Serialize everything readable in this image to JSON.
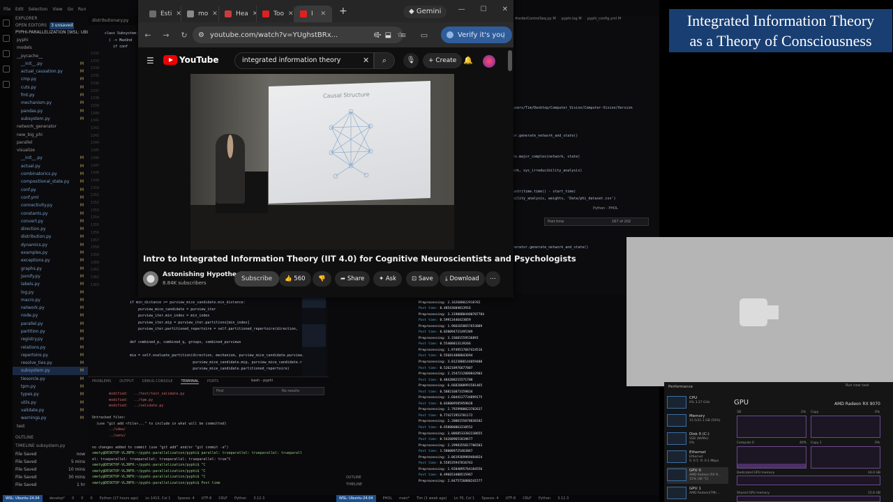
{
  "vscode": {
    "menu": [
      "File",
      "Edit",
      "Selection",
      "View",
      "Go",
      "Run"
    ],
    "explorer_header": "EXPLORER",
    "open_editors": "OPEN EDITORS",
    "open_editors_badge": "3 unsaved",
    "project": "PYPHI-PARALLELIZATION [WSL: UBUNTU-24.04]",
    "tree": [
      {
        "label": "pyphi",
        "type": "folder"
      },
      {
        "label": "models",
        "type": "folder"
      },
      {
        "label": "__pycache__",
        "type": "folder"
      },
      {
        "label": "__init__.py",
        "m": "M"
      },
      {
        "label": "actual_causation.py",
        "m": "M"
      },
      {
        "label": "cmp.py",
        "m": "M"
      },
      {
        "label": "cuts.py",
        "m": "M"
      },
      {
        "label": "fmt.py",
        "m": "M"
      },
      {
        "label": "mechanism.py",
        "m": "M"
      },
      {
        "label": "pandas.py",
        "m": "M"
      },
      {
        "label": "subsystem.py",
        "m": "M"
      },
      {
        "label": "network_generator",
        "type": "folder"
      },
      {
        "label": "new_big_phi",
        "type": "folder"
      },
      {
        "label": "parallel",
        "type": "folder"
      },
      {
        "label": "visualize",
        "type": "folder"
      },
      {
        "label": "__init__.py",
        "m": "M"
      },
      {
        "label": "actual.py",
        "m": "M"
      },
      {
        "label": "combinatorics.py",
        "m": "M"
      },
      {
        "label": "compositional_state.py",
        "m": "M"
      },
      {
        "label": "conf.py",
        "m": "M"
      },
      {
        "label": "conf.yml",
        "m": "M"
      },
      {
        "label": "connectivity.py",
        "m": "M"
      },
      {
        "label": "constants.py",
        "m": "M"
      },
      {
        "label": "convert.py",
        "m": "M"
      },
      {
        "label": "direction.py",
        "m": "M"
      },
      {
        "label": "distribution.py",
        "m": "M"
      },
      {
        "label": "dynamics.py",
        "m": "M"
      },
      {
        "label": "examples.py",
        "m": "M"
      },
      {
        "label": "exceptions.py",
        "m": "M"
      },
      {
        "label": "graphs.py",
        "m": "M"
      },
      {
        "label": "jsonify.py",
        "m": "M"
      },
      {
        "label": "labels.py",
        "m": "M"
      },
      {
        "label": "log.py",
        "m": "M"
      },
      {
        "label": "macro.py",
        "m": "M"
      },
      {
        "label": "network.py",
        "m": "M"
      },
      {
        "label": "node.py",
        "m": "M"
      },
      {
        "label": "parallel.py",
        "m": "M"
      },
      {
        "label": "partition.py",
        "m": "M"
      },
      {
        "label": "registry.py",
        "m": "M"
      },
      {
        "label": "relations.py",
        "m": "M"
      },
      {
        "label": "repertoire.py",
        "m": "M"
      },
      {
        "label": "resolve_ties.py",
        "m": "M"
      },
      {
        "label": "subsystem.py",
        "m": "M",
        "selected": true
      },
      {
        "label": "tiesorcle.py",
        "m": "M"
      },
      {
        "label": "tpm.py",
        "m": "M"
      },
      {
        "label": "types.py",
        "m": "M"
      },
      {
        "label": "utils.py",
        "m": "M"
      },
      {
        "label": "validate.py",
        "m": "M"
      },
      {
        "label": "warnings.py",
        "m": "M"
      },
      {
        "label": "test",
        "type": "folder"
      }
    ],
    "outline": "OUTLINE",
    "timeline": "TIMELINE subsystem.py",
    "timeline_items": [
      {
        "label": "File Saved",
        "time": "now"
      },
      {
        "label": "File Saved",
        "time": "5 mins"
      },
      {
        "label": "File Saved",
        "time": "10 mins"
      },
      {
        "label": "File Saved",
        "time": "30 mins"
      },
      {
        "label": "File Saved",
        "time": "1 hr"
      }
    ],
    "editor_tab": "distributionary.py",
    "code_top": [
      "class Subsystem:",
      "  ) -> MaxUnd",
      "    if conf"
    ],
    "line_numbers": [
      "1332",
      "1333",
      "1334",
      "1335",
      "1336",
      "1337",
      "1338",
      "1339",
      "1340",
      "1341",
      "1342",
      "1343",
      "1344",
      "1345",
      "1346",
      "1347",
      "1348",
      "1349",
      "1350",
      "1351",
      "1352",
      "1353",
      "1354",
      "1355",
      "1356",
      "1357",
      "1358",
      "1359",
      "1360",
      "1361",
      "1362",
      "1363"
    ],
    "code_bottom": [
      "if min_distance >= purview_mice_candidate.min_distance:",
      "    purview_mice_candidate = purview_iter",
      "    purview_iter.min_index = min_index",
      "    purview_iter.mip = purview_iter.partitions[min_index]",
      "    purview_iter.partitioned_repertoire = self.partitioned_repertoire(direction,",
      "",
      "def combined_p, combined_q, groups, combined_purviews",
      "",
      "mia = self.evaluate_partition(direction, mechanism, purview_mice_candidate.purview,",
      "                              purview_mice_candidate.mip, purview_mice_candidate.r",
      "                              purview_mice_candidate.partitioned_repertoire)"
    ],
    "panel_tabs": [
      "PROBLEMS",
      "OUTPUT",
      "DEBUG CONSOLE",
      "TERMINAL",
      "PORTS"
    ],
    "panel_active": "TERMINAL",
    "terminal_name": "bash - pyphi",
    "find_placeholder": "Find",
    "find_result": "No results",
    "terminal_lines": [
      {
        "t": "        modified:   ../test/test_validate.py",
        "c": "r"
      },
      {
        "t": "        modified:   ../tpm.py",
        "c": "r"
      },
      {
        "t": "        modified:   ../validate.py",
        "c": "r"
      },
      {
        "t": "",
        "c": "w"
      },
      {
        "t": "Untracked files:",
        "c": "w"
      },
      {
        "t": "  (use \"git add <file>...\" to include in what will be committed)",
        "c": "w"
      },
      {
        "t": "        ../idea/",
        "c": "r"
      },
      {
        "t": "        ../venv/",
        "c": "r"
      },
      {
        "t": "",
        "c": "w"
      },
      {
        "t": "no changes added to commit (use \"git add\" and/or \"git commit -a\")",
        "c": "w"
      },
      {
        "t": "smety@DESKTOP-VLJNFR:~/pyphi-parallelization/pyphi$ parallel: trueparallel: trueparallel: trueparall",
        "c": "g"
      },
      {
        "t": "el: trueparallel: trueparallel: trueparallel: trueparallel: true^C",
        "c": "w"
      },
      {
        "t": "smety@DESKTOP-VLJNFR:~/pyphi-parallelization/pyphi$ ^C",
        "c": "g"
      },
      {
        "t": "smety@DESKTOP-VLJNFR:~/pyphi-parallelization/pyphi$ ^C",
        "c": "g"
      },
      {
        "t": "smety@DESKTOP-VLJNFR:~/pyphi-parallelization/pyphi$ ^C",
        "c": "g"
      },
      {
        "t": "smety@DESKTOP-VLJNFR:~/pyphi-parallelization/pyphi$ Post time",
        "c": "g"
      }
    ],
    "right_tabs": [
      "#orderControlSeq.py M",
      "pyphi.log M",
      "pyphi_config.yml M"
    ],
    "right_code": [
      "users/Tim/Desktop/Computer_Vision/Computer-Vision/Version",
      "",
      "",
      "",
      "or.generate_network_and_state()",
      "",
      "",
      "ns.major_complex(network, state)",
      "",
      "ork, sys_irreducibility_analysis)",
      "",
      "",
      "ustr(time.time() - start_time)",
      "bility_analysis, weights, 'Data/phi_dataset.csv')",
      "",
      "",
      "",
      "",
      "",
      "",
      "nerator.generate_network_and_state()"
    ],
    "right_find_value": "Post time",
    "right_find_result": "167 of 202",
    "right_panel_label": "Python - PHOL",
    "output_lines": [
      {
        "k": "Post time:",
        "v": "0.50006413421123"
      },
      {
        "k": "Preprocessing:",
        "v": "2.16260802291870I"
      },
      {
        "k": "Post time:",
        "v": "0.48543604013916"
      },
      {
        "k": "Preprocessing:",
        "v": "3.31900804400707784"
      },
      {
        "k": "Post time:",
        "v": "0.59913446423059"
      },
      {
        "k": "Preprocessing:",
        "v": "1.9661658657653889"
      },
      {
        "k": "Post time:",
        "v": "0.020094721495389"
      },
      {
        "k": "Preprocessing:",
        "v": "3.3368155953689I"
      },
      {
        "k": "Post time:",
        "v": "0.55408013119266"
      },
      {
        "k": "Preprocessing:",
        "v": "1.9749517667424516"
      },
      {
        "k": "Post time:",
        "v": "0.556814888043694"
      },
      {
        "k": "Preprocessing:",
        "v": "3.8123888144059480"
      },
      {
        "k": "Post time:",
        "v": "0.526218976677807"
      },
      {
        "k": "Preprocessing:",
        "v": "2.2547212888842903"
      },
      {
        "k": "Post time:",
        "v": "0.484288215571708"
      },
      {
        "k": "Preprocessing:",
        "v": "6.6682000991581465"
      },
      {
        "k": "Post time:",
        "v": "0.588216073159834"
      },
      {
        "k": "Preprocessing:",
        "v": "1.6044127734899175"
      },
      {
        "k": "Post time:",
        "v": "0.038809585959828"
      },
      {
        "k": "Preprocessing:",
        "v": "2.7929900023702637"
      },
      {
        "k": "Post time:",
        "v": "0.774272953781172"
      },
      {
        "k": "Preprocessing:",
        "v": "2.2006155078838182"
      },
      {
        "k": "Post time:",
        "v": "0.658880863310552"
      },
      {
        "k": "Preprocessing:",
        "v": "3.0868533382238655"
      },
      {
        "k": "Post time:",
        "v": "0.542689651819677"
      },
      {
        "k": "Preprocessing:",
        "v": "2.2998355817706583"
      },
      {
        "k": "Post time:",
        "v": "1.580089725463867"
      },
      {
        "k": "Preprocessing:",
        "v": "3.0619369969484824"
      },
      {
        "k": "Post time:",
        "v": "0.558535947816763"
      },
      {
        "k": "Preprocessing:",
        "v": "1.9284095764184556"
      },
      {
        "k": "Post time:",
        "v": "0.496653480515967"
      },
      {
        "k": "Preprocessing:",
        "v": "2.8475726888241577"
      }
    ],
    "outline2": "OUTLINE",
    "timeline2": "TIMELINE",
    "status": [
      "WSL: Ubuntu-24.04",
      "develop*",
      "0",
      "0",
      "0",
      "Python (17 hours ago)",
      "Ln 1413, Col 1",
      "Spaces: 4",
      "UTF-8",
      "CRLF",
      "Python",
      "3.12.3"
    ],
    "status_right": [
      "WSL: Ubuntu-24.04",
      "PHOL",
      "main*",
      "Tim (1 week ago)",
      "Ln 76, Col 1",
      "Spaces: 4",
      "UTF-8",
      "CRLF",
      "Python",
      "3.12.3"
    ]
  },
  "chrome": {
    "tabs": [
      {
        "label": "Esti",
        "fav": "#6b6b6b"
      },
      {
        "label": "mo",
        "fav": "#8a8a8a"
      },
      {
        "label": "Hea",
        "fav": "#c83c3c"
      },
      {
        "label": "Too",
        "fav": "#e02020"
      },
      {
        "label": "I",
        "fav": "#e02020",
        "active": true
      }
    ],
    "new_tab": "+",
    "gemini": "Gemini",
    "url": "youtube.com/watch?v=YUghstBRx...",
    "verify": "Verify it's you"
  },
  "youtube": {
    "logo": "YouTube",
    "search_value": "integrated information theory",
    "create": "+ Create",
    "slide_text": "Causal Structure",
    "title": "Intro to Integrated Information Theory (IIT 4.0) for Cognitive Neuroscientists and Psychologists",
    "channel": "Astonishing Hypothesis",
    "subs": "8.84K subscribers",
    "subscribe": "Subscribe",
    "likes": "560",
    "share": "Share",
    "ask": "Ask",
    "save": "Save",
    "download": "Download"
  },
  "slide": {
    "line1": "Integrated Information Theory",
    "line2": "as a Theory of Consciousness"
  },
  "taskmgr": {
    "title": "Performance",
    "run_task": "Run new task",
    "items": [
      {
        "name": "CPU",
        "sub": "6% 3.27 GHz"
      },
      {
        "name": "Memory",
        "sub": "15.5/31.1 GB (50%)"
      },
      {
        "name": "Disk 0 (C:)",
        "sub": "SSD (NVMe)\n0%"
      },
      {
        "name": "Ethernet",
        "sub": "Ethernet\nS: 0.5  R: 0.1 Mbps"
      },
      {
        "name": "GPU 0",
        "sub": "AMD Radeon RX 9...\n15% (40 °C)",
        "selected": true
      },
      {
        "name": "GPU 1",
        "sub": "AMD Radeon(TM) ..."
      }
    ],
    "gpu_title": "GPU",
    "gpu_name": "AMD Radeon RX 9070",
    "graph_labels": [
      "3D",
      "2%",
      "Copy",
      "0%",
      "Compute 0",
      "40%",
      "Copy 1",
      "0%"
    ],
    "dedicated": "Dedicated GPU memory",
    "dedicated_max": "16.0 GB",
    "shared": "Shared GPU memory",
    "shared_max": "15.6 GB"
  }
}
